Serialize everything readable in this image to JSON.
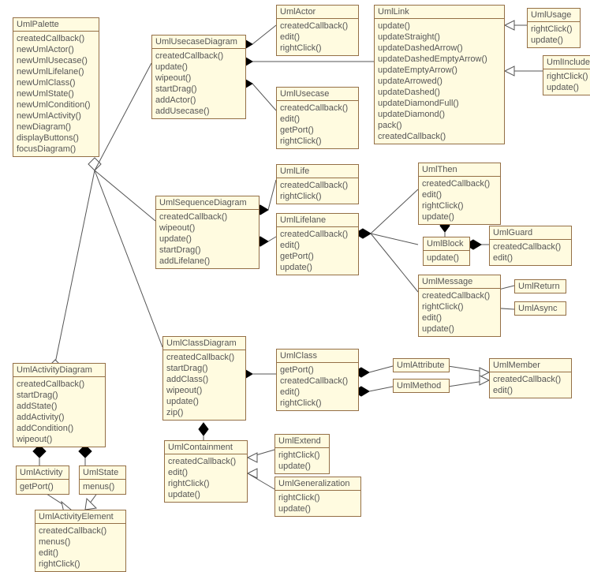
{
  "classes": {
    "UmlPalette": {
      "name": "UmlPalette",
      "methods": [
        "createdCallback()",
        "newUmlActor()",
        "newUmlUsecase()",
        "newUmlLifelane()",
        "newUmlClass()",
        "newUmlState()",
        "newUmlCondition()",
        "newUmlActivity()",
        "newDiagram()",
        "displayButtons()",
        "focusDiagram()"
      ]
    },
    "UmlUsecaseDiagram": {
      "name": "UmlUsecaseDiagram",
      "methods": [
        "createdCallback()",
        "update()",
        "wipeout()",
        "startDrag()",
        "addActor()",
        "addUsecase()"
      ]
    },
    "UmlActor": {
      "name": "UmlActor",
      "methods": [
        "createdCallback()",
        "edit()",
        "rightClick()"
      ]
    },
    "UmlUsecase": {
      "name": "UmlUsecase",
      "methods": [
        "createdCallback()",
        "edit()",
        "getPort()",
        "rightClick()"
      ]
    },
    "UmlLink": {
      "name": "UmlLink",
      "methods": [
        "update()",
        "updateStraight()",
        "updateDashedArrow()",
        "updateDashedEmptyArrow()",
        "updateEmptyArrow()",
        "updateArrowed()",
        "updateDashed()",
        "updateDiamondFull()",
        "updateDiamond()",
        "pack()",
        "createdCallback()"
      ]
    },
    "UmlUsage": {
      "name": "UmlUsage",
      "methods": [
        "rightClick()",
        "update()"
      ]
    },
    "UmlInclude": {
      "name": "UmlInclude",
      "methods": [
        "rightClick()",
        "update()"
      ]
    },
    "UmlSequenceDiagram": {
      "name": "UmlSequenceDiagram",
      "methods": [
        "createdCallback()",
        "wipeout()",
        "update()",
        "startDrag()",
        "addLifelane()"
      ]
    },
    "UmlLife": {
      "name": "UmlLife",
      "methods": [
        "createdCallback()",
        "rightClick()"
      ]
    },
    "UmlLifelane": {
      "name": "UmlLifelane",
      "methods": [
        "createdCallback()",
        "edit()",
        "getPort()",
        "update()"
      ]
    },
    "UmlThen": {
      "name": "UmlThen",
      "methods": [
        "createdCallback()",
        "edit()",
        "rightClick()",
        "update()"
      ]
    },
    "UmlBlock": {
      "name": "UmlBlock",
      "methods": [
        "update()"
      ]
    },
    "UmlGuard": {
      "name": "UmlGuard",
      "methods": [
        "createdCallback()",
        "edit()"
      ]
    },
    "UmlMessage": {
      "name": "UmlMessage",
      "methods": [
        "createdCallback()",
        "rightClick()",
        "edit()",
        "update()"
      ]
    },
    "UmlReturn": {
      "name": "UmlReturn",
      "methods": []
    },
    "UmlAsync": {
      "name": "UmlAsync",
      "methods": []
    },
    "UmlClassDiagram": {
      "name": "UmlClassDiagram",
      "methods": [
        "createdCallback()",
        "startDrag()",
        "addClass()",
        "wipeout()",
        "update()",
        "zip()"
      ]
    },
    "UmlClass": {
      "name": "UmlClass",
      "methods": [
        "getPort()",
        "createdCallback()",
        "edit()",
        "rightClick()"
      ]
    },
    "UmlAttribute": {
      "name": "UmlAttribute",
      "methods": []
    },
    "UmlMethod": {
      "name": "UmlMethod",
      "methods": []
    },
    "UmlMember": {
      "name": "UmlMember",
      "methods": [
        "createdCallback()",
        "edit()"
      ]
    },
    "UmlContainment": {
      "name": "UmlContainment",
      "methods": [
        "createdCallback()",
        "edit()",
        "rightClick()",
        "update()"
      ]
    },
    "UmlExtend": {
      "name": "UmlExtend",
      "methods": [
        "rightClick()",
        "update()"
      ]
    },
    "UmlGeneralization": {
      "name": "UmlGeneralization",
      "methods": [
        "rightClick()",
        "update()"
      ]
    },
    "UmlActivityDiagram": {
      "name": "UmlActivityDiagram",
      "methods": [
        "createdCallback()",
        "startDrag()",
        "addState()",
        "addActivity()",
        "addCondition()",
        "wipeout()"
      ]
    },
    "UmlActivity": {
      "name": "UmlActivity",
      "methods": [
        "getPort()"
      ]
    },
    "UmlState": {
      "name": "UmlState",
      "methods": [
        "menus()"
      ]
    },
    "UmlActivityElement": {
      "name": "UmlActivityElement",
      "methods": [
        "createdCallback()",
        "menus()",
        "edit()",
        "rightClick()"
      ]
    }
  },
  "relations": [
    {
      "from": "UmlPalette",
      "to": "UmlUsecaseDiagram",
      "type": "aggregation"
    },
    {
      "from": "UmlPalette",
      "to": "UmlSequenceDiagram",
      "type": "aggregation"
    },
    {
      "from": "UmlPalette",
      "to": "UmlClassDiagram",
      "type": "aggregation"
    },
    {
      "from": "UmlPalette",
      "to": "UmlActivityDiagram",
      "type": "aggregation"
    },
    {
      "from": "UmlUsecaseDiagram",
      "to": "UmlActor",
      "type": "composition"
    },
    {
      "from": "UmlUsecaseDiagram",
      "to": "UmlUsecase",
      "type": "composition"
    },
    {
      "from": "UmlUsecaseDiagram",
      "to": "UmlLink",
      "type": "composition"
    },
    {
      "from": "UmlUsage",
      "to": "UmlLink",
      "type": "generalization"
    },
    {
      "from": "UmlInclude",
      "to": "UmlLink",
      "type": "generalization"
    },
    {
      "from": "UmlSequenceDiagram",
      "to": "UmlLife",
      "type": "composition"
    },
    {
      "from": "UmlSequenceDiagram",
      "to": "UmlLifelane",
      "type": "composition"
    },
    {
      "from": "UmlLifelane",
      "to": "UmlThen",
      "type": "composition"
    },
    {
      "from": "UmlLifelane",
      "to": "UmlBlock",
      "type": "composition"
    },
    {
      "from": "UmlLifelane",
      "to": "UmlMessage",
      "type": "composition"
    },
    {
      "from": "UmlThen",
      "to": "UmlBlock",
      "type": "composition"
    },
    {
      "from": "UmlGuard",
      "to": "UmlBlock",
      "type": "composition"
    },
    {
      "from": "UmlReturn",
      "to": "UmlMessage",
      "type": "generalization"
    },
    {
      "from": "UmlAsync",
      "to": "UmlMessage",
      "type": "generalization"
    },
    {
      "from": "UmlClassDiagram",
      "to": "UmlClass",
      "type": "composition"
    },
    {
      "from": "UmlClassDiagram",
      "to": "UmlContainment",
      "type": "composition"
    },
    {
      "from": "UmlClass",
      "to": "UmlAttribute",
      "type": "composition"
    },
    {
      "from": "UmlClass",
      "to": "UmlMethod",
      "type": "composition"
    },
    {
      "from": "UmlAttribute",
      "to": "UmlMember",
      "type": "generalization"
    },
    {
      "from": "UmlMethod",
      "to": "UmlMember",
      "type": "generalization"
    },
    {
      "from": "UmlExtend",
      "to": "UmlContainment",
      "type": "generalization"
    },
    {
      "from": "UmlGeneralization",
      "to": "UmlContainment",
      "type": "generalization"
    },
    {
      "from": "UmlActivityDiagram",
      "to": "UmlActivity",
      "type": "composition"
    },
    {
      "from": "UmlActivityDiagram",
      "to": "UmlState",
      "type": "composition"
    },
    {
      "from": "UmlActivity",
      "to": "UmlActivityElement",
      "type": "generalization"
    },
    {
      "from": "UmlState",
      "to": "UmlActivityElement",
      "type": "generalization"
    }
  ]
}
